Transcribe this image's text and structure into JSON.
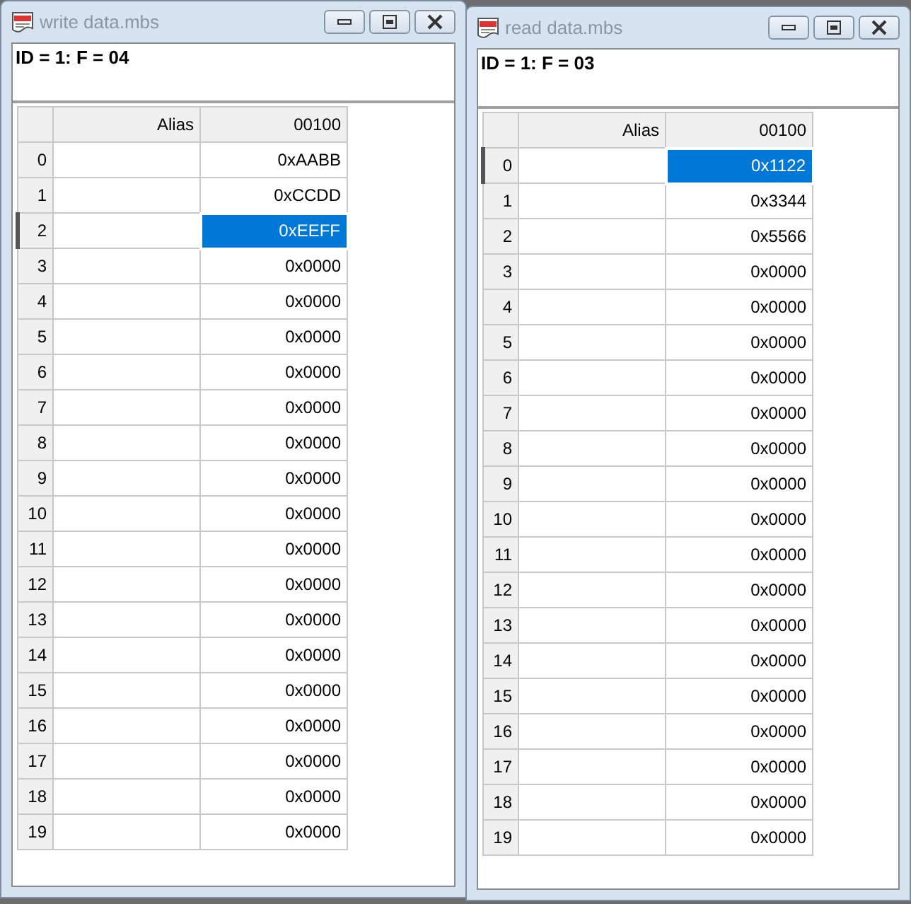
{
  "windows": [
    {
      "title": "write data.mbs",
      "info": "ID = 1: F = 04",
      "columns": [
        "Alias",
        "00100"
      ],
      "rows": [
        {
          "index": "0",
          "value": "0xAABB",
          "selected": false
        },
        {
          "index": "1",
          "value": "0xCCDD",
          "selected": false
        },
        {
          "index": "2",
          "value": "0xEEFF",
          "selected": true
        },
        {
          "index": "3",
          "value": "0x0000",
          "selected": false
        },
        {
          "index": "4",
          "value": "0x0000",
          "selected": false
        },
        {
          "index": "5",
          "value": "0x0000",
          "selected": false
        },
        {
          "index": "6",
          "value": "0x0000",
          "selected": false
        },
        {
          "index": "7",
          "value": "0x0000",
          "selected": false
        },
        {
          "index": "8",
          "value": "0x0000",
          "selected": false
        },
        {
          "index": "9",
          "value": "0x0000",
          "selected": false
        },
        {
          "index": "10",
          "value": "0x0000",
          "selected": false
        },
        {
          "index": "11",
          "value": "0x0000",
          "selected": false
        },
        {
          "index": "12",
          "value": "0x0000",
          "selected": false
        },
        {
          "index": "13",
          "value": "0x0000",
          "selected": false
        },
        {
          "index": "14",
          "value": "0x0000",
          "selected": false
        },
        {
          "index": "15",
          "value": "0x0000",
          "selected": false
        },
        {
          "index": "16",
          "value": "0x0000",
          "selected": false
        },
        {
          "index": "17",
          "value": "0x0000",
          "selected": false
        },
        {
          "index": "18",
          "value": "0x0000",
          "selected": false
        },
        {
          "index": "19",
          "value": "0x0000",
          "selected": false
        }
      ]
    },
    {
      "title": "read data.mbs",
      "info": "ID = 1: F = 03",
      "columns": [
        "Alias",
        "00100"
      ],
      "rows": [
        {
          "index": "0",
          "value": "0x1122",
          "selected": true
        },
        {
          "index": "1",
          "value": "0x3344",
          "selected": false
        },
        {
          "index": "2",
          "value": "0x5566",
          "selected": false
        },
        {
          "index": "3",
          "value": "0x0000",
          "selected": false
        },
        {
          "index": "4",
          "value": "0x0000",
          "selected": false
        },
        {
          "index": "5",
          "value": "0x0000",
          "selected": false
        },
        {
          "index": "6",
          "value": "0x0000",
          "selected": false
        },
        {
          "index": "7",
          "value": "0x0000",
          "selected": false
        },
        {
          "index": "8",
          "value": "0x0000",
          "selected": false
        },
        {
          "index": "9",
          "value": "0x0000",
          "selected": false
        },
        {
          "index": "10",
          "value": "0x0000",
          "selected": false
        },
        {
          "index": "11",
          "value": "0x0000",
          "selected": false
        },
        {
          "index": "12",
          "value": "0x0000",
          "selected": false
        },
        {
          "index": "13",
          "value": "0x0000",
          "selected": false
        },
        {
          "index": "14",
          "value": "0x0000",
          "selected": false
        },
        {
          "index": "15",
          "value": "0x0000",
          "selected": false
        },
        {
          "index": "16",
          "value": "0x0000",
          "selected": false
        },
        {
          "index": "17",
          "value": "0x0000",
          "selected": false
        },
        {
          "index": "18",
          "value": "0x0000",
          "selected": false
        },
        {
          "index": "19",
          "value": "0x0000",
          "selected": false
        }
      ]
    }
  ]
}
